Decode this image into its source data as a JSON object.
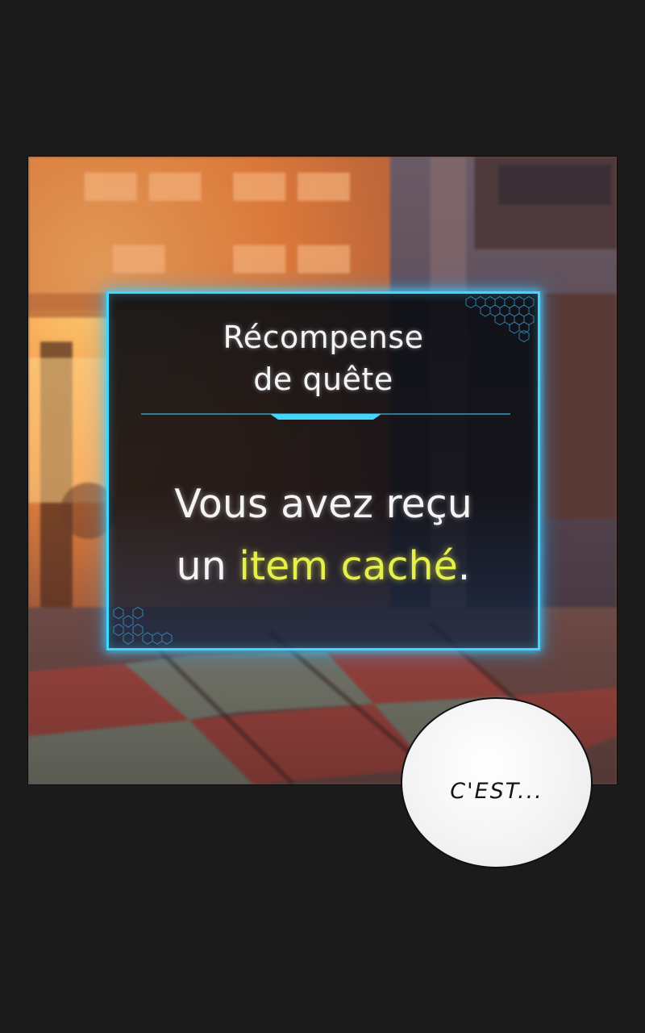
{
  "quest_window": {
    "title_line1": "Récompense",
    "title_line2": "de quête",
    "message_part1": "Vous avez reçu",
    "message_part2_prefix": "un ",
    "message_highlight": "item caché",
    "message_suffix": "."
  },
  "speech_bubble": {
    "text": "C'EST..."
  },
  "colors": {
    "window_border": "#3fd6ff",
    "highlight_text": "#e6f04a",
    "page_background": "#1b1b1b"
  }
}
